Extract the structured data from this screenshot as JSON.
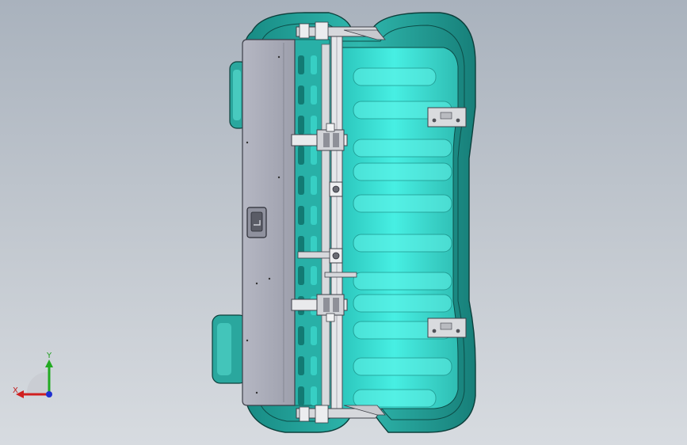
{
  "viewport": {
    "background_top": "#a9b2bd",
    "background_bottom": "#d7dbe0",
    "model": {
      "name": "seat-assembly-top-view",
      "colors": {
        "shell": "#1f9e96",
        "shell_highlight": "#3fd6c9",
        "cushion": "#40e8dc",
        "cushion_light": "#7ff3ea",
        "outline": "#0c3f3b",
        "panel": "#a7a9b6",
        "bracket": "#d6d8dc",
        "rail": "#e6e7ea"
      }
    }
  },
  "triad": {
    "x_label": "X",
    "y_label": "Y",
    "x_color": "#d02020",
    "y_color": "#22aa22",
    "z_color": "#2030d0"
  }
}
